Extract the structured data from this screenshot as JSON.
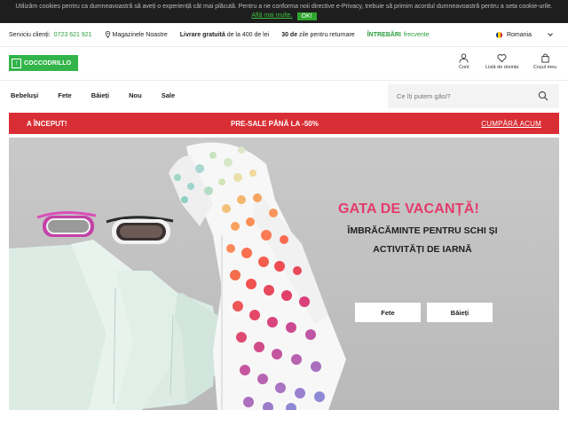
{
  "cookie": {
    "text": "Utilizăm cookies pentru ca dumneavoastră să aveți o experiență cât mai plăcută. Pentru a ne conforma noii directive e-Privacy, trebuie să primim acordul dumneavoastră pentru a seta cookie-urile.",
    "more_link": "Află mai multe.",
    "ok_label": "OK!"
  },
  "util": {
    "service_label": "Serviciu clienți:",
    "phone": "0723 621 921",
    "stores": "Magazinele Noastre",
    "delivery_strong": "Livrare gratuită",
    "delivery_rest": "de la 400 de lei",
    "returns_strong": "30 de",
    "returns_rest": "zile pentru returnare",
    "faq_strong": "ÎNTREBĂRI",
    "faq_rest": "frecvente",
    "language": "Romania"
  },
  "header": {
    "logo_text": "COCCODRILLO",
    "account_label": "Cont",
    "wishlist_label": "Listă de dorințe",
    "cart_label": "Coșul meu"
  },
  "nav": {
    "items": [
      "Bebeluși",
      "Fete",
      "Băieți",
      "Nou",
      "Sale"
    ],
    "search_placeholder": "Ce îți putem găsi?"
  },
  "promo": {
    "left": "A ÎNCEPUT!",
    "center": "PRE-SALE PÂNĂ LA -50%",
    "right": "CUMPĂRĂ ACUM"
  },
  "hero": {
    "title": "GATA DE VACANȚĂ!",
    "subtitle": "ÎMBRĂCĂMINTE PENTRU SCHI ȘI ACTIVITĂȚI DE IARNĂ",
    "btn_girls": "Fete",
    "btn_boys": "Băieți"
  },
  "colors": {
    "brand_green": "#32b44a",
    "promo_red": "#d92e35",
    "hero_title_pink": "#e53a6c",
    "hero_bg": "#c2c2c2"
  }
}
